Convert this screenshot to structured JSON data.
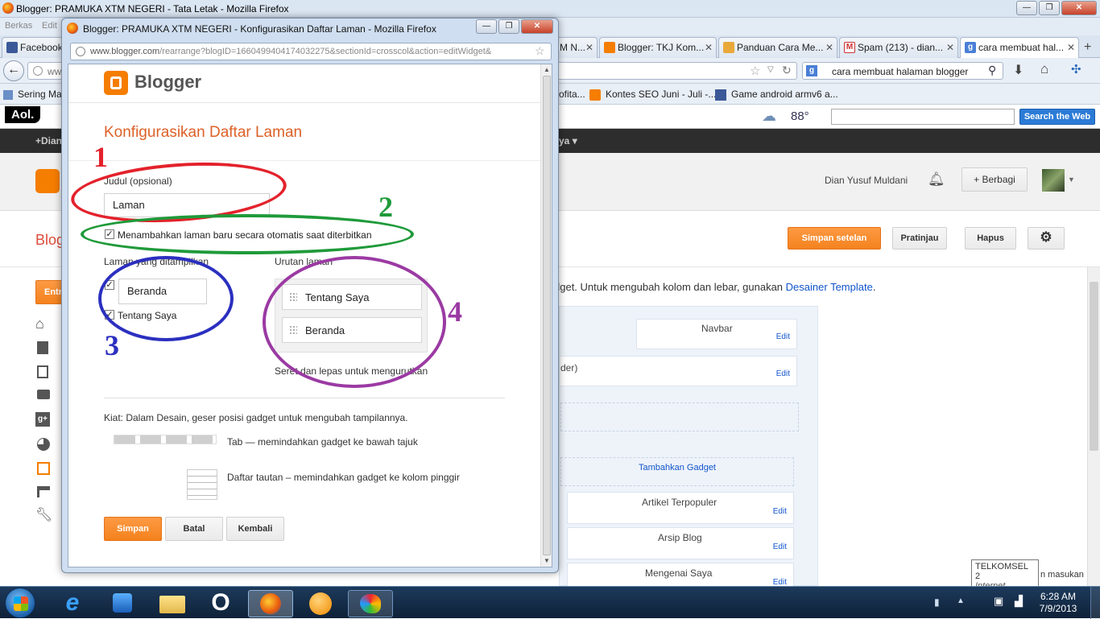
{
  "main_window": {
    "title": "Blogger: PRAMUKA XTM NEGERI - Tata Letak - Mozilla Firefox",
    "menu": [
      "Berkas",
      "Edit"
    ],
    "tabs": [
      {
        "label": "Facebook",
        "icon": "facebook-icon"
      },
      {
        "label": "M N...",
        "icon": "generic-icon"
      },
      {
        "label": "Blogger: TKJ Kom...",
        "icon": "blogger-icon"
      },
      {
        "label": "Panduan Cara Me...",
        "icon": "pencil-icon"
      },
      {
        "label": "Spam (213) - dian...",
        "icon": "gmail-icon"
      },
      {
        "label": "cara membuat hal...",
        "icon": "google-icon"
      }
    ],
    "address_partial": "ww",
    "search_value": "cara membuat halaman blogger",
    "bookmarks": [
      {
        "label": "Sering Ma"
      },
      {
        "label": "ofita..."
      },
      {
        "label": "Kontes SEO Juni - Juli -..."
      },
      {
        "label": "Game android armv6 a..."
      }
    ],
    "aol_logo": "Aol.",
    "weather": "88°",
    "search_web_label": "Search the Web",
    "blackbar_left": "+Dian",
    "blackbar_right": "ya",
    "user_name": "Dian Yusuf Muldani",
    "share_label": "Berbagi",
    "blog_title_partial": "Blog",
    "save_settings_label": "Simpan setelan",
    "preview_label": "Pratinjau",
    "delete_label": "Hapus",
    "entri_label": "Entri",
    "layout_hint": "dget. Untuk mengubah kolom dan lebar, gunakan",
    "layout_hint_link": "Desainer Template",
    "layout_hint_end": ".",
    "gadgets": {
      "navbar": "Navbar",
      "header_partial": "der)",
      "add_gadget": "Tambahkan Gadget",
      "popular": "Artikel Terpopuler",
      "archive": "Arsip Blog",
      "about": "Mengenai Saya",
      "edit": "Edit"
    },
    "tooltip": {
      "line1": "TELKOMSEL  2",
      "line2": "Internet access",
      "behind": "n masukan"
    },
    "clock": {
      "time": "6:28 AM",
      "date": "7/9/2013"
    }
  },
  "popup": {
    "title": "Blogger: PRAMUKA XTM NEGERI - Konfigurasikan Daftar Laman - Mozilla Firefox",
    "url_host": "www.blogger.com",
    "url_rest": "/rearrange?blogID=1660499404174032275&sectionId=crosscol&action=editWidget&",
    "brand": "Blogger",
    "heading": "Konfigurasikan Daftar Laman",
    "title_label": "Judul (opsional)",
    "title_value": "Laman",
    "auto_add_label": "Menambahkan laman baru secara otomatis saat diterbitkan",
    "auto_add_checked": true,
    "shown_pages_label": "Laman yang ditampilkan",
    "pages": [
      {
        "label": "Beranda",
        "checked": true
      },
      {
        "label": "Tentang Saya",
        "checked": true
      }
    ],
    "order_label": "Urutan laman",
    "order": [
      "Tentang Saya",
      "Beranda"
    ],
    "drag_hint": "Seret dan lepas untuk mengurutkan",
    "tip": "Kiat: Dalam Desain, geser posisi gadget untuk mengubah tampilannya.",
    "tab_tip": "Tab — memindahkan gadget ke bawah tajuk",
    "list_tip": "Daftar tautan – memindahkan gadget ke kolom pinggir",
    "save_label": "Simpan",
    "cancel_label": "Batal",
    "back_label": "Kembali"
  },
  "annotations": [
    {
      "number": "1",
      "color": "#e3222c"
    },
    {
      "number": "2",
      "color": "#1f9a3a"
    },
    {
      "number": "3",
      "color": "#2b2fbf"
    },
    {
      "number": "4",
      "color": "#9b3aa3"
    }
  ],
  "colors": {
    "accent": "#f4821e",
    "blogger_orange": "#f57d00",
    "link": "#15c"
  }
}
